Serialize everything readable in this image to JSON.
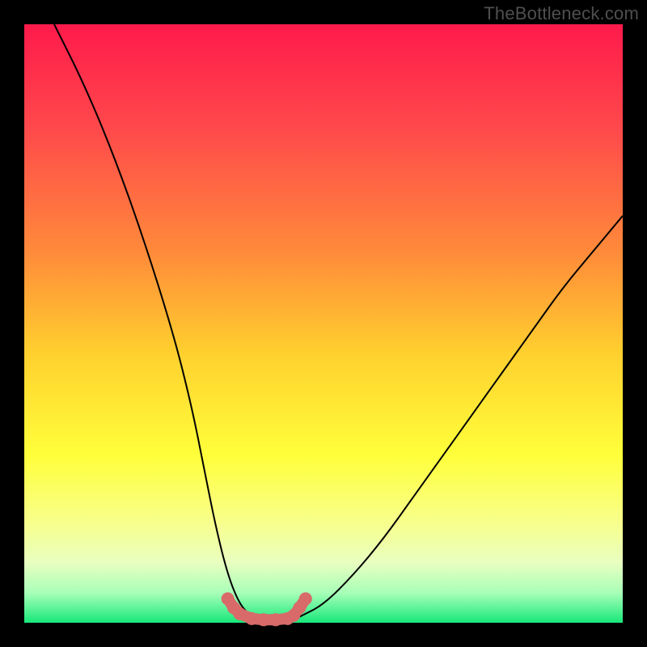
{
  "watermark": "TheBottleneck.com",
  "gradient": {
    "stops": [
      {
        "pct": 0,
        "color": "#ff1a4b"
      },
      {
        "pct": 18,
        "color": "#ff4b4b"
      },
      {
        "pct": 38,
        "color": "#ff8a3a"
      },
      {
        "pct": 55,
        "color": "#ffd02e"
      },
      {
        "pct": 72,
        "color": "#ffff3a"
      },
      {
        "pct": 83,
        "color": "#f8ff8a"
      },
      {
        "pct": 90,
        "color": "#e8ffc0"
      },
      {
        "pct": 95,
        "color": "#a8ffb8"
      },
      {
        "pct": 100,
        "color": "#17e87a"
      }
    ]
  },
  "chart_data": {
    "type": "line",
    "title": "",
    "xlabel": "",
    "ylabel": "",
    "xlim": [
      0,
      100
    ],
    "ylim": [
      0,
      100
    ],
    "series": [
      {
        "name": "bottleneck-curve",
        "x": [
          5,
          10,
          15,
          20,
          25,
          28,
          30,
          32,
          34,
          36,
          38,
          40,
          42,
          44,
          46,
          50,
          55,
          60,
          65,
          70,
          75,
          80,
          85,
          90,
          95,
          100
        ],
        "values": [
          100,
          90,
          78,
          64,
          48,
          36,
          26,
          16,
          8,
          3,
          1,
          0,
          0,
          0,
          1,
          3,
          8,
          14,
          21,
          28,
          35,
          42,
          49,
          56,
          62,
          68
        ]
      },
      {
        "name": "bottom-markers",
        "x": [
          34,
          35,
          36,
          38,
          40,
          42,
          44,
          45,
          46,
          47
        ],
        "values": [
          4,
          2.5,
          1.5,
          0.7,
          0.5,
          0.5,
          0.7,
          1.2,
          2.5,
          4
        ]
      }
    ],
    "colors": {
      "curve": "#000000",
      "markers": "#d86a6a"
    }
  }
}
